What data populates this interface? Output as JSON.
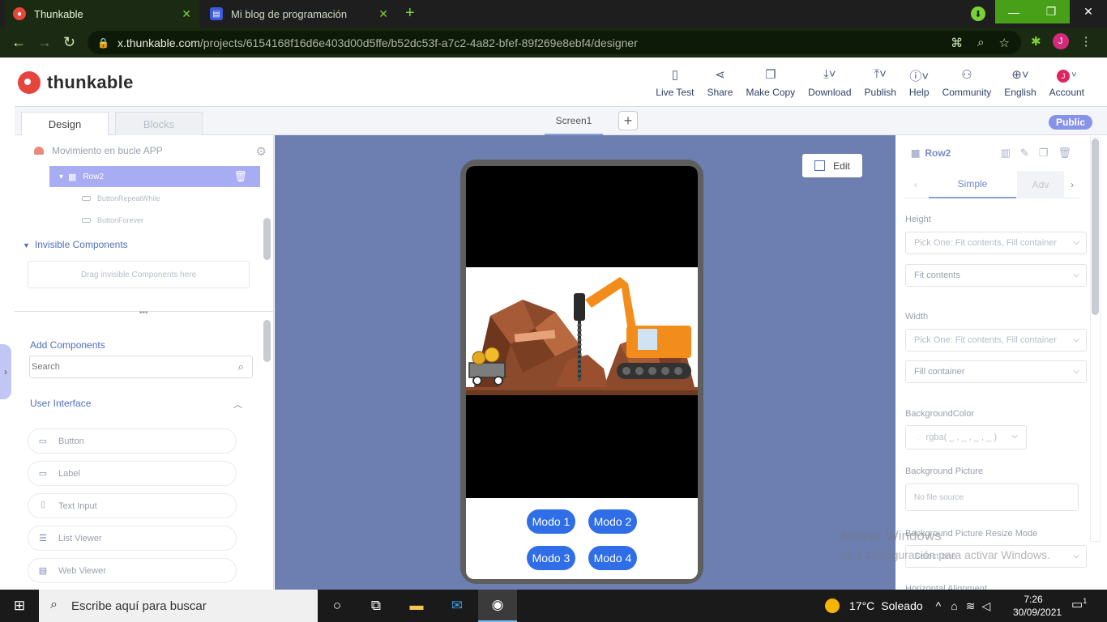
{
  "browser": {
    "tabs": [
      {
        "title": "Thunkable",
        "active": true
      },
      {
        "title": "Mi blog de programación",
        "active": false
      }
    ],
    "url_host": "x.thunkable.com",
    "url_path": "/projects/6154168f16d6e403d00d5ffe/b52dc53f-a7c2-4a82-bfef-89f269e8ebf4/designer",
    "profile_initial": "J"
  },
  "header": {
    "logo_text": "thunkable",
    "tools": [
      {
        "label": "Live Test",
        "icon": "phone-icon"
      },
      {
        "label": "Share",
        "icon": "share-icon"
      },
      {
        "label": "Make Copy",
        "icon": "copy-icon"
      },
      {
        "label": "Download",
        "icon": "download-icon"
      },
      {
        "label": "Publish",
        "icon": "upload-icon"
      },
      {
        "label": "Help",
        "icon": "info-icon"
      },
      {
        "label": "Community",
        "icon": "community-icon"
      },
      {
        "label": "English",
        "icon": "globe-icon"
      },
      {
        "label": "Account",
        "icon": "avatar-icon"
      }
    ],
    "account_initial": "J"
  },
  "designer_tabs": {
    "design": "Design",
    "blocks": "Blocks",
    "screen": "Screen1",
    "add": "+",
    "visibility": "Public"
  },
  "left_panel": {
    "project_name": "Movimiento en bucle APP",
    "selected_component": "Row2",
    "children": [
      "ButtonRepeatWhile",
      "ButtonForever"
    ],
    "invisible_title": "Invisible Components",
    "drop_hint": "Drag invisible Components here",
    "add_title": "Add Components",
    "search_placeholder": "Search",
    "category": "User Interface",
    "components": [
      "Button",
      "Label",
      "Text Input",
      "List Viewer",
      "Web Viewer"
    ]
  },
  "canvas": {
    "edit_label": "Edit",
    "buttons": [
      "Modo 1",
      "Modo 2",
      "Modo 3",
      "Modo 4"
    ],
    "watermark_title": "Activar Windows",
    "watermark_sub": "Ve a Configuración para activar Windows."
  },
  "right_panel": {
    "component": "Row2",
    "tab_simple": "Simple",
    "tab_advanced": "Adv",
    "height_label": "Height",
    "height_pick": "Pick One: Fit contents, Fill container",
    "height_value": "Fit contents",
    "width_label": "Width",
    "width_pick": "Pick One: Fit contents, Fill container",
    "width_value": "Fill container",
    "bgcolor_label": "BackgroundColor",
    "bgcolor_value": "rgba( _ , _ , _ , _ )",
    "bgpicture_label": "Background Picture",
    "bgpicture_value": "No file source",
    "resize_label": "Background Picture Resize Mode",
    "resize_value": "Select one",
    "halign_label": "Horizontal Alignment"
  },
  "taskbar": {
    "search_text": "Escribe aquí para buscar",
    "weather_temp": "17°C",
    "weather_desc": "Soleado",
    "time": "7:26",
    "date": "30/09/2021",
    "notifications": "1"
  },
  "colors": {
    "brand_green": "#79d136",
    "canvas_bg": "#6c7fb0",
    "selection": "#a8acf2",
    "modo_button": "#2f6ee6",
    "public_badge": "#8792e9"
  }
}
